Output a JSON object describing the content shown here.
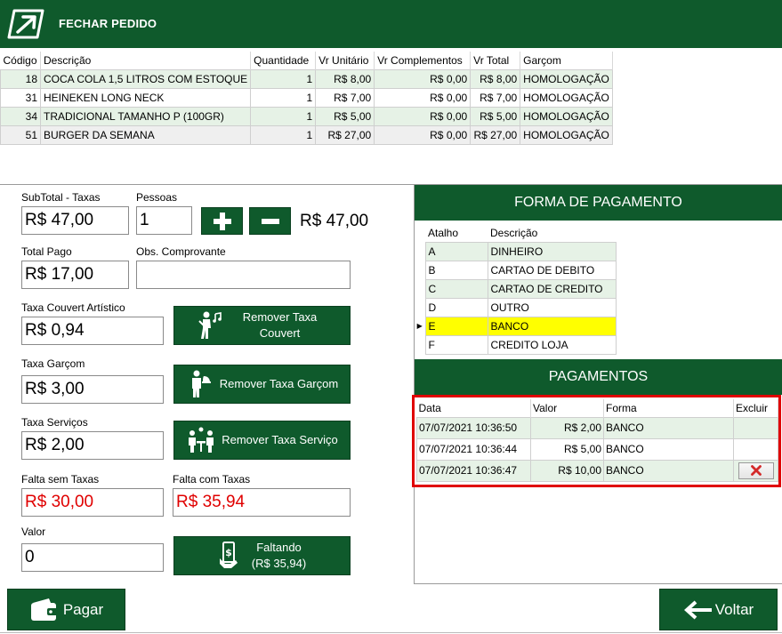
{
  "header": {
    "title": "FECHAR PEDIDO",
    "logo_icon": "arrow-box-icon"
  },
  "items": {
    "columns": [
      "Código",
      "Descrição",
      "Quantidade",
      "Vr Unitário",
      "Vr Complementos",
      "Vr Total",
      "Garçom"
    ],
    "rows": [
      {
        "codigo": "18",
        "descricao": "COCA COLA 1,5 LITROS COM ESTOQUE",
        "quantidade": "1",
        "unitario": "R$ 8,00",
        "complementos": "R$ 0,00",
        "total": "R$ 8,00",
        "garcom": "HOMOLOGAÇÃO"
      },
      {
        "codigo": "31",
        "descricao": "HEINEKEN LONG NECK",
        "quantidade": "1",
        "unitario": "R$ 7,00",
        "complementos": "R$ 0,00",
        "total": "R$ 7,00",
        "garcom": "HOMOLOGAÇÃO"
      },
      {
        "codigo": "34",
        "descricao": "TRADICIONAL TAMANHO P (100GR)",
        "quantidade": "1",
        "unitario": "R$ 5,00",
        "complementos": "R$ 0,00",
        "total": "R$ 5,00",
        "garcom": "HOMOLOGAÇÃO"
      },
      {
        "codigo": "51",
        "descricao": "BURGER DA SEMANA",
        "quantidade": "1",
        "unitario": "R$ 27,00",
        "complementos": "R$ 0,00",
        "total": "R$ 27,00",
        "garcom": "HOMOLOGAÇÃO"
      }
    ]
  },
  "form": {
    "subtotal_label": "SubTotal - Taxas",
    "subtotal_value": "R$ 47,00",
    "pessoas_label": "Pessoas",
    "pessoas_value": "1",
    "per_person": "R$ 47,00",
    "total_pago_label": "Total Pago",
    "total_pago_value": "R$ 17,00",
    "obs_label": "Obs. Comprovante",
    "obs_value": "",
    "couvert_label": "Taxa Couvert Artístico",
    "couvert_value": "R$ 0,94",
    "remover_couvert": "Remover Taxa Couvert",
    "garcom_label": "Taxa Garçom",
    "garcom_value": "R$ 3,00",
    "remover_garcom": "Remover Taxa Garçom",
    "servicos_label": "Taxa Serviços",
    "servicos_value": "R$ 2,00",
    "remover_servico": "Remover Taxa Serviço",
    "falta_sem_label": "Falta sem Taxas",
    "falta_sem_value": "R$ 30,00",
    "falta_com_label": "Falta com Taxas",
    "falta_com_value": "R$ 35,94",
    "valor_label": "Valor",
    "valor_value": "0",
    "faltando_line1": "Faltando",
    "faltando_line2": "(R$ 35,94)",
    "pagar": "Pagar",
    "voltar": "Voltar"
  },
  "forma_pagamento": {
    "title": "FORMA DE PAGAMENTO",
    "columns": [
      "Atalho",
      "Descrição"
    ],
    "rows": [
      {
        "atalho": "A",
        "descricao": "DINHEIRO"
      },
      {
        "atalho": "B",
        "descricao": "CARTAO DE DEBITO"
      },
      {
        "atalho": "C",
        "descricao": "CARTAO DE CREDITO"
      },
      {
        "atalho": "D",
        "descricao": "OUTRO"
      },
      {
        "atalho": "E",
        "descricao": "BANCO"
      },
      {
        "atalho": "F",
        "descricao": "CREDITO LOJA"
      }
    ],
    "selected_index": 4
  },
  "pagamentos": {
    "title": "PAGAMENTOS",
    "columns": [
      "Data",
      "Valor",
      "Forma",
      "Excluir"
    ],
    "rows": [
      {
        "data": "07/07/2021 10:36:50",
        "valor": "R$ 2,00",
        "forma": "BANCO"
      },
      {
        "data": "07/07/2021 10:36:44",
        "valor": "R$ 5,00",
        "forma": "BANCO"
      },
      {
        "data": "07/07/2021 10:36:47",
        "valor": "R$ 10,00",
        "forma": "BANCO"
      }
    ]
  },
  "colors": {
    "brand_green": "#0f5a2c",
    "row_green": "#e6f2e6",
    "selected": "#ffff00",
    "alert_red": "#e00000"
  }
}
